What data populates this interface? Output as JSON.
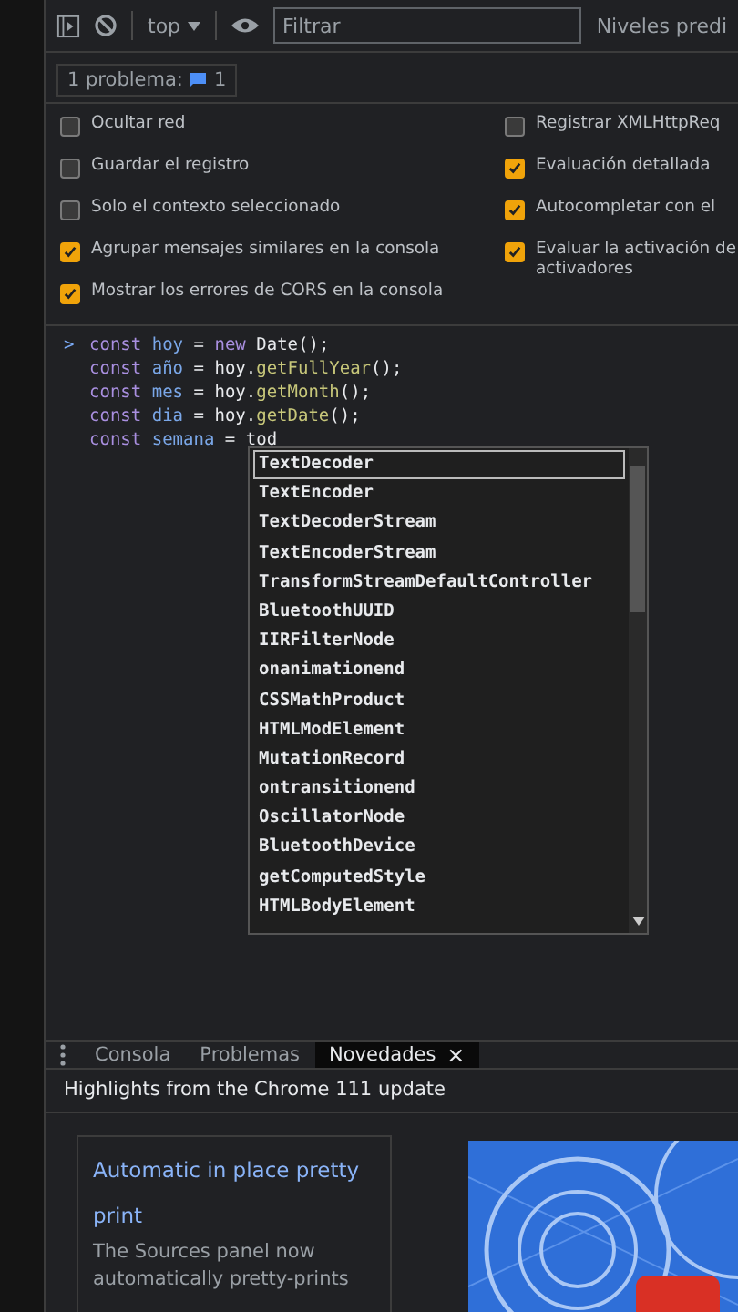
{
  "toolbar": {
    "context": "top",
    "filter": {
      "placeholder": "Filtrar"
    },
    "levels": "Niveles predi"
  },
  "issues": {
    "label": "1 problema:",
    "count": "1"
  },
  "settings": {
    "left": [
      {
        "label": "Ocultar red",
        "checked": false
      },
      {
        "label": "Guardar el registro",
        "checked": false
      },
      {
        "label": "Solo el contexto seleccionado",
        "checked": false
      },
      {
        "label": "Agrupar mensajes similares en la consola",
        "checked": true
      },
      {
        "label": "Mostrar los errores de CORS en la consola",
        "checked": true
      }
    ],
    "right": [
      {
        "label": "Registrar XMLHttpReq",
        "checked": false
      },
      {
        "label": "Evaluación detallada",
        "checked": true
      },
      {
        "label": "Autocompletar con el",
        "checked": true
      },
      {
        "label": "Evaluar la activación de activadores",
        "checked": true
      }
    ]
  },
  "prompt": ">",
  "code": [
    [
      {
        "kind": "keyword",
        "text": "const"
      },
      {
        "kind": "variable",
        "text": "hoy"
      },
      {
        "kind": "plain",
        "text": "="
      },
      {
        "kind": "keyword",
        "text": "new"
      },
      {
        "kind": "plain",
        "text": "Date();"
      }
    ],
    [
      {
        "kind": "keyword",
        "text": "const"
      },
      {
        "kind": "variable",
        "text": "año"
      },
      {
        "kind": "plain",
        "text": "="
      },
      {
        "kind": "plain",
        "text": "hoy."
      },
      {
        "kind": "method",
        "text": "getFullYear",
        "join": true
      },
      {
        "kind": "plain",
        "text": "();",
        "join": true
      }
    ],
    [
      {
        "kind": "keyword",
        "text": "const"
      },
      {
        "kind": "variable",
        "text": "mes"
      },
      {
        "kind": "plain",
        "text": "="
      },
      {
        "kind": "plain",
        "text": "hoy."
      },
      {
        "kind": "method",
        "text": "getMonth",
        "join": true
      },
      {
        "kind": "plain",
        "text": "();",
        "join": true
      }
    ],
    [
      {
        "kind": "keyword",
        "text": "const"
      },
      {
        "kind": "variable",
        "text": "dia"
      },
      {
        "kind": "plain",
        "text": "="
      },
      {
        "kind": "plain",
        "text": "hoy."
      },
      {
        "kind": "method",
        "text": "getDate",
        "join": true
      },
      {
        "kind": "plain",
        "text": "();",
        "join": true
      }
    ],
    [
      {
        "kind": "keyword",
        "text": "const"
      },
      {
        "kind": "variable",
        "text": "semana"
      },
      {
        "kind": "plain",
        "text": "="
      },
      {
        "kind": "plain",
        "text": "tod"
      }
    ]
  ],
  "suggestions": [
    {
      "text": "TextDecoder",
      "selected": true
    },
    {
      "text": "TextEncoder",
      "selected": false
    },
    {
      "text": "TextDecoderStream",
      "selected": false
    },
    {
      "text": "TextEncoderStream",
      "selected": false
    },
    {
      "text": "TransformStreamDefaultController",
      "selected": false
    },
    {
      "text": "BluetoothUUID",
      "selected": false
    },
    {
      "text": "IIRFilterNode",
      "selected": false
    },
    {
      "text": "onanimationend",
      "selected": false
    },
    {
      "text": "CSSMathProduct",
      "selected": false
    },
    {
      "text": "HTMLModElement",
      "selected": false
    },
    {
      "text": "MutationRecord",
      "selected": false
    },
    {
      "text": "ontransitionend",
      "selected": false
    },
    {
      "text": "OscillatorNode",
      "selected": false
    },
    {
      "text": "BluetoothDevice",
      "selected": false
    },
    {
      "text": "getComputedStyle",
      "selected": false
    },
    {
      "text": "HTMLBodyElement",
      "selected": false
    }
  ],
  "drawer": {
    "tabs": [
      {
        "label": "Consola",
        "selected": false,
        "closable": false
      },
      {
        "label": "Problemas",
        "selected": false,
        "closable": false
      },
      {
        "label": "Novedades",
        "selected": true,
        "closable": true
      }
    ],
    "close": "×",
    "heading": "Highlights from the Chrome 111 update",
    "card": {
      "title": "Automatic in place pretty print",
      "text": "The Sources panel now automatically pretty-prints"
    }
  }
}
